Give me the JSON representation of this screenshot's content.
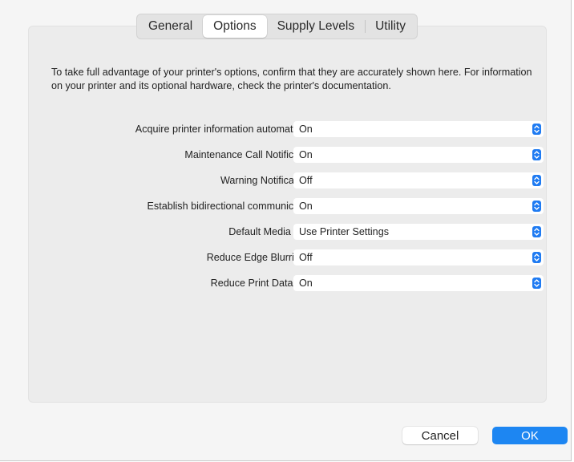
{
  "tabs": [
    {
      "label": "General",
      "active": false
    },
    {
      "label": "Options",
      "active": true
    },
    {
      "label": "Supply Levels",
      "active": false
    },
    {
      "label": "Utility",
      "active": false
    }
  ],
  "intro_text": "To take full advantage of your printer's options, confirm that they are accurately shown here. For information on your printer and its optional hardware, check the printer's documentation.",
  "options": [
    {
      "label": "Acquire printer information automatically:",
      "value": "On"
    },
    {
      "label": "Maintenance Call Notification:",
      "value": "On"
    },
    {
      "label": "Warning Notifications:",
      "value": "Off"
    },
    {
      "label": "Establish bidirectional communication:",
      "value": "On"
    },
    {
      "label": "Default Media Type:",
      "value": "Use Printer Settings"
    },
    {
      "label": "Reduce Edge Blurriness:",
      "value": "Off"
    },
    {
      "label": "Reduce Print Data Size:",
      "value": "On"
    }
  ],
  "buttons": {
    "cancel": "Cancel",
    "ok": "OK"
  },
  "colors": {
    "accent": "#1d86f2",
    "stepper": "#1f7bf2"
  },
  "icons": {
    "popup_arrows": "up-down-chevron-icon"
  }
}
